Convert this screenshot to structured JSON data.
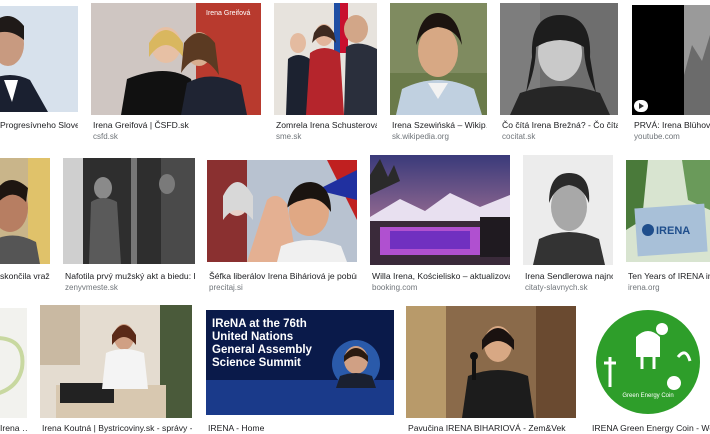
{
  "results": [
    {
      "title": "Progresívneho Slove…",
      "source": ""
    },
    {
      "title": "Irena Greifová | ČSFD.sk",
      "source": "csfd.sk"
    },
    {
      "title": "Zomrela Irena Schusterová…",
      "source": "sme.sk"
    },
    {
      "title": "Irena Szewińská – Wikip…",
      "source": "sk.wikipedia.org"
    },
    {
      "title": "Čo čítá Irena Brežná? - Čo čítat?",
      "source": "cocitat.sk"
    },
    {
      "title": "PRVÁ: Irena Blühová - …",
      "source": "youtube.com"
    },
    {
      "title": "skončila vraž…",
      "source": ""
    },
    {
      "title": "Nafotila prvý mužský akt a biedu: P…",
      "source": "zenyvmeste.sk"
    },
    {
      "title": "Šéfka liberálov Irena Biháriová je pobúre…",
      "source": "precitaj.si"
    },
    {
      "title": "Willa Irena, Kościelisko – aktualizova…",
      "source": "booking.com"
    },
    {
      "title": "Irena Sendlerowa najno…",
      "source": "citaty-slavnych.sk"
    },
    {
      "title": "Ten Years of IRENA in G",
      "source": "irena.org"
    },
    {
      "title": "Irena …",
      "source": ""
    },
    {
      "title": "Irena Koutná | Bystricoviny.sk - správy - k…",
      "source": ""
    },
    {
      "title": "IRENA - Home",
      "source": ""
    },
    {
      "title": "Pavučina IRENA BIHARIOVÁ - Zem&Vek",
      "source": ""
    },
    {
      "title": "IRENA Green Energy Coin - We …",
      "source": ""
    }
  ],
  "thumb_text": {
    "csfd_sign": "Irena Greifová",
    "irena_logo": "IRENA",
    "irena_headline": "IReNA at the 76th United Nations General Assembly Science Summit",
    "coin_label": "Green Energy Coin"
  }
}
